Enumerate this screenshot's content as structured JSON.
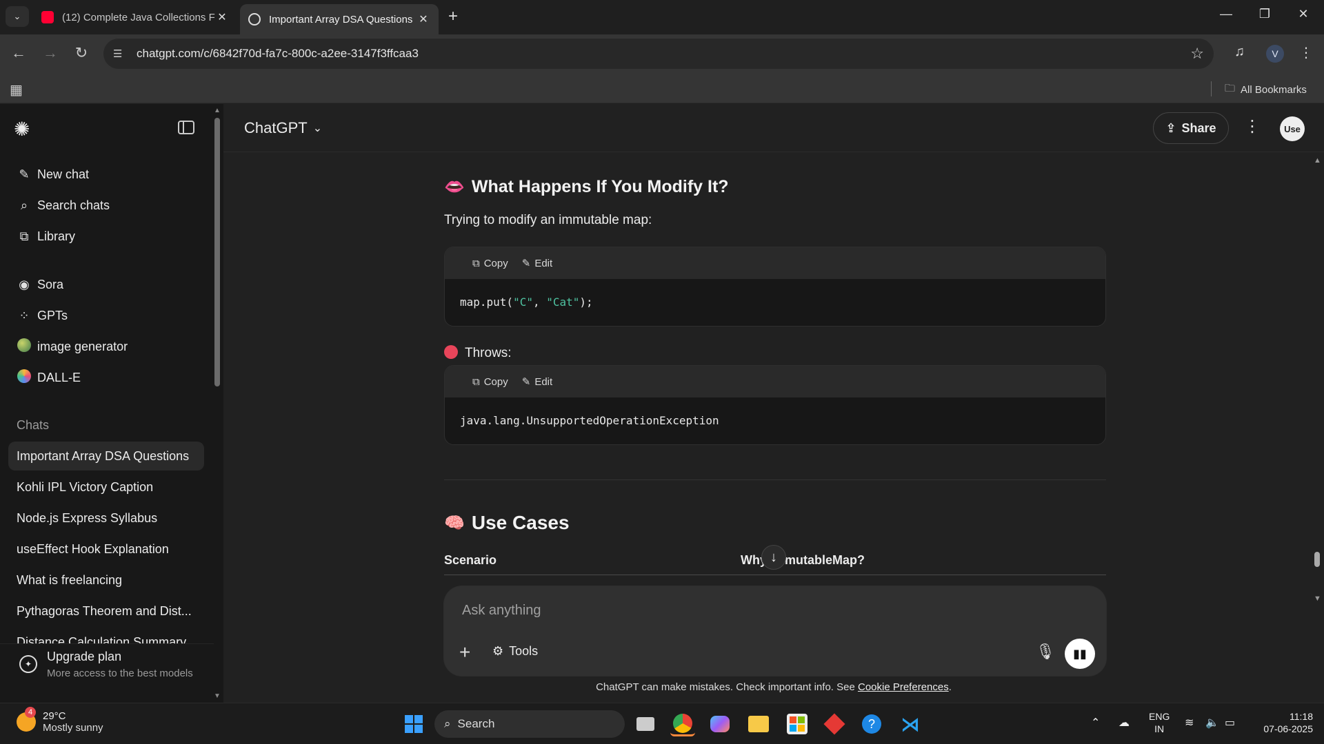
{
  "browser": {
    "tabs": [
      {
        "title": "(12) Complete Java Collections F",
        "active": false,
        "favicon": "youtube-icon"
      },
      {
        "title": "Important Array DSA Questions",
        "active": true,
        "favicon": "chatgpt-icon"
      }
    ],
    "url": "chatgpt.com/c/6842f70d-fa7c-800c-a2ee-3147f3ffcaa3",
    "profile_initial": "V",
    "bookmarks_label": "All Bookmarks"
  },
  "sidebar": {
    "primary": [
      {
        "label": "New chat",
        "icon": "compose-icon"
      },
      {
        "label": "Search chats",
        "icon": "search-icon"
      },
      {
        "label": "Library",
        "icon": "library-icon"
      }
    ],
    "apps": [
      {
        "label": "Sora",
        "icon": "play-circle-icon"
      },
      {
        "label": "GPTs",
        "icon": "grid-icon"
      },
      {
        "label": "image generator",
        "icon": "image-generator-icon"
      },
      {
        "label": "DALL-E",
        "icon": "dalle-icon"
      }
    ],
    "section_label": "Chats",
    "chats": [
      "Important Array DSA Questions",
      "Kohli IPL Victory Caption",
      "Node.js Express Syllabus",
      "useEffect Hook Explanation",
      "What is freelancing",
      "Pythagoras Theorem and Dist...",
      "Distance Calculation Summary"
    ],
    "upgrade": {
      "title": "Upgrade plan",
      "subtitle": "More access to the best models"
    }
  },
  "header": {
    "model": "ChatGPT",
    "share_label": "Share",
    "avatar_text": "Use"
  },
  "content": {
    "modify_heading": "What Happens If You Modify It?",
    "modify_emoji": "👄",
    "modify_para": "Trying to modify an immutable map:",
    "code1": {
      "lang": "java",
      "copy": "Copy",
      "edit": "Edit",
      "code_prefix": "map.put(",
      "arg1": "\"C\"",
      "sep": ", ",
      "arg2": "\"Cat\"",
      "code_suffix": ");"
    },
    "throws_label": "Throws:",
    "code2": {
      "lang": "text",
      "copy": "Copy",
      "edit": "Edit",
      "code": "java.lang.UnsupportedOperationException"
    },
    "use_cases_heading": "Use Cases",
    "use_cases_emoji": "🧠",
    "table_headers": [
      "Scenario",
      "Why ImmutableMap?"
    ]
  },
  "composer": {
    "placeholder": "Ask anything",
    "tools_label": "Tools"
  },
  "disclaimer": {
    "text": "ChatGPT can make mistakes. Check important info. See ",
    "link": "Cookie Preferences",
    "end": "."
  },
  "taskbar": {
    "weather_temp": "29°C",
    "weather_desc": "Mostly sunny",
    "weather_badge": "4",
    "search_label": "Search",
    "lang_line1": "ENG",
    "lang_line2": "IN",
    "time": "11:18",
    "date": "07-06-2025"
  }
}
